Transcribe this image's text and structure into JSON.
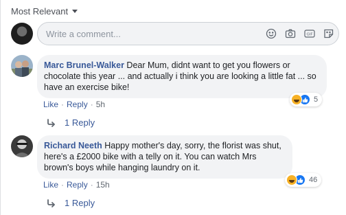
{
  "sort": {
    "label": "Most Relevant"
  },
  "composer": {
    "placeholder": "Write a comment...",
    "icons": [
      "emoji-icon",
      "camera-icon",
      "gif-icon",
      "sticker-icon"
    ]
  },
  "comments": [
    {
      "author": "Marc Brunel-Walker",
      "text": "Dear Mum, didnt want to get you flowers or chocolate this year ... and actually i think you are looking a little fat ... so have an exercise bike!",
      "like_label": "Like",
      "reply_label": "Reply",
      "timestamp": "5h",
      "reaction_count": "5",
      "reactions": [
        "haha",
        "like"
      ],
      "replies_label": "1 Reply"
    },
    {
      "author": "Richard Neeth",
      "text": "Happy mother's day, sorry, the florist was shut, here's a £2000 bike with a telly on it. You can watch Mrs brown's boys while hanging laundry on it.",
      "like_label": "Like",
      "reply_label": "Reply",
      "timestamp": "15h",
      "reaction_count": "46",
      "reactions": [
        "haha",
        "like"
      ],
      "replies_label": "1 Reply"
    }
  ],
  "colors": {
    "link": "#385898",
    "bubble": "#f2f3f5",
    "muted": "#606770",
    "like_blue": "#1877f2",
    "haha_yellow": "#f7b125"
  }
}
